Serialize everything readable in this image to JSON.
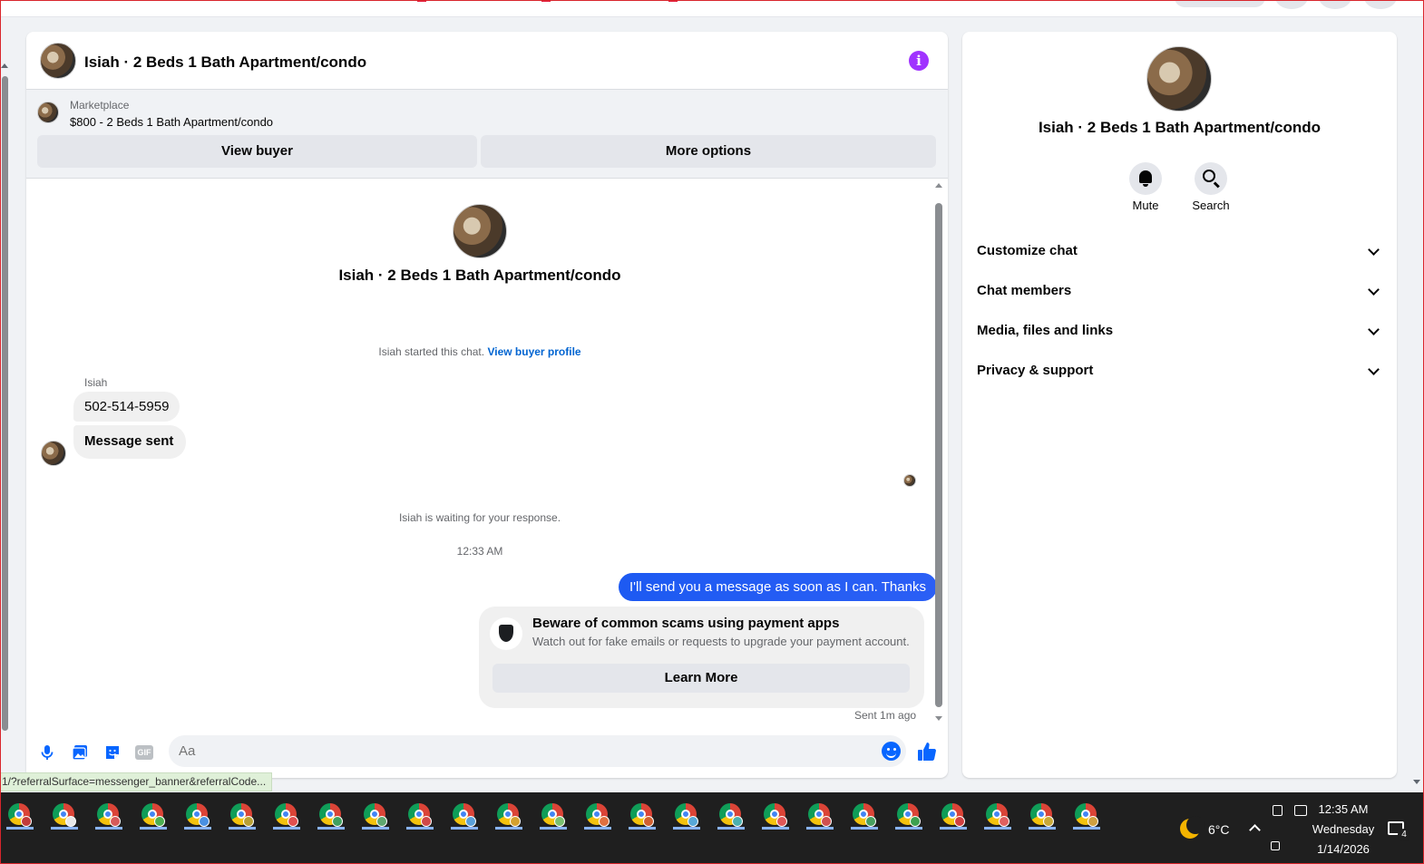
{
  "chat": {
    "title": "Isiah · 2 Beds 1 Bath Apartment/condo",
    "marketplace_label": "Marketplace",
    "listing": "$800 - 2 Beds 1 Bath Apartment/condo",
    "view_buyer_label": "View buyer",
    "more_options_label": "More options",
    "info_icon_glyph": "i"
  },
  "conversation": {
    "intro_title": "Isiah · 2 Beds 1 Bath Apartment/condo",
    "started_text": "Isiah started this chat.",
    "view_profile_link": "View buyer profile",
    "sender_name": "Isiah",
    "incoming": [
      "502-514-5959",
      "Message sent"
    ],
    "waiting_text": "Isiah is waiting for your response.",
    "timestamp": "12:33 AM",
    "outgoing": "I'll send you a message as soon as I can. Thanks",
    "scam_title": "Beware of common scams using payment apps",
    "scam_text": "Watch out for fake emails or requests to upgrade your payment account.",
    "learn_more_label": "Learn More",
    "sent_status": "Sent 1m ago"
  },
  "composer": {
    "placeholder": "Aa",
    "gif_label": "GIF",
    "icons": [
      "microphone-icon",
      "photo-icon",
      "sticker-icon",
      "gif-icon",
      "emoji-icon",
      "thumbs-up-icon"
    ]
  },
  "sidebar": {
    "title": "Isiah · 2 Beds 1 Bath Apartment/condo",
    "mute_label": "Mute",
    "search_label": "Search",
    "sections": [
      "Customize chat",
      "Chat members",
      "Media, files and links",
      "Privacy & support"
    ]
  },
  "status_url": "1/?referralSurface=messenger_banner&referralCode...",
  "taskbar": {
    "temperature": "6°C",
    "time": "12:35 AM",
    "day": "Wednesday",
    "date": "1/14/2026",
    "notification_count": "4",
    "app_badges": [
      "#c23b3b",
      "#e8e8e8",
      "#d65a5a",
      "#4caf50",
      "#4a90e2",
      "#b8a035",
      "#e05050",
      "#3fa060",
      "#60a870",
      "#d04848",
      "#5aa0d8",
      "#d4a030",
      "#7ac070",
      "#e07040",
      "#d06030",
      "#58a8d8",
      "#4ab0b0",
      "#e05858",
      "#d05050",
      "#48a060",
      "#3da050",
      "#d04040",
      "#e06060",
      "#c8a838",
      "#d0a040"
    ]
  },
  "colors": {
    "accent": "#0866ff",
    "outgoing_bubble": "#1d5af2",
    "info": "#a033ff",
    "link": "#0064d1"
  }
}
